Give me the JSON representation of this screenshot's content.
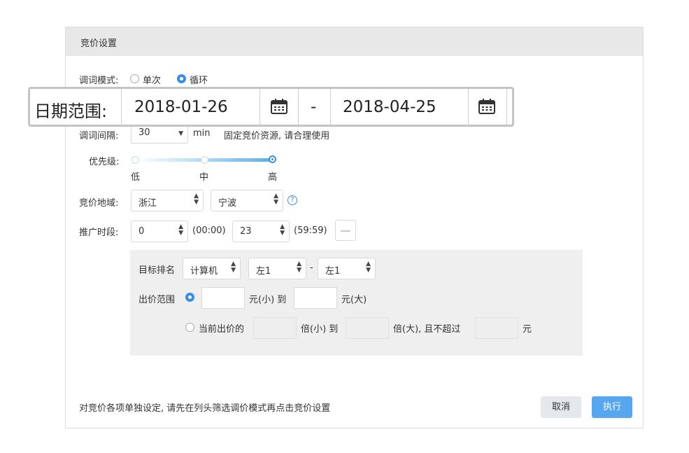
{
  "panel": {
    "title": "竞价设置"
  },
  "mode": {
    "label": "调词模式:",
    "options": [
      "单次",
      "循环"
    ],
    "selected": "循环"
  },
  "date_overlay": {
    "label": "日期范围:",
    "start": "2018-01-26",
    "separator": "-",
    "end": "2018-04-25"
  },
  "interval": {
    "label": "调词间隔:",
    "value": "30",
    "unit": "min",
    "note": "固定竞价资源, 请合理使用"
  },
  "priority": {
    "label": "优先级:",
    "levels": [
      "低",
      "中",
      "高"
    ],
    "selected": "高"
  },
  "region": {
    "label": "竞价地域:",
    "province": "浙江",
    "city": "宁波",
    "help_icon": "?"
  },
  "schedule": {
    "label": "推广时段:",
    "start": "0",
    "start_time": "(00:00)",
    "end": "23",
    "end_time": "(59:59)"
  },
  "rank": {
    "label": "目标排名",
    "device": "计算机",
    "from": "左1",
    "dash": "-",
    "to": "左1"
  },
  "price_range": {
    "label": "出价范围",
    "yuan_small": "元(小) 到",
    "yuan_large": "元(大)",
    "current_label": "当前出价的",
    "times_small": "倍(小) 到",
    "times_large": "倍(大), 且不超过",
    "yuan": "元"
  },
  "footer": {
    "note": "对竞价各项单独设定, 请先在列头筛选调价模式再点击竞价设置",
    "cancel": "取消",
    "execute": "执行"
  },
  "colors": {
    "accent": "#3a8ee6",
    "execute_button": "#56a7ef",
    "header_bg": "#e8e8e8",
    "sub_panel_bg": "#efefef"
  },
  "icons": [
    "calendar-icon",
    "question-icon",
    "dropdown-arrow-icon",
    "minus-icon"
  ]
}
